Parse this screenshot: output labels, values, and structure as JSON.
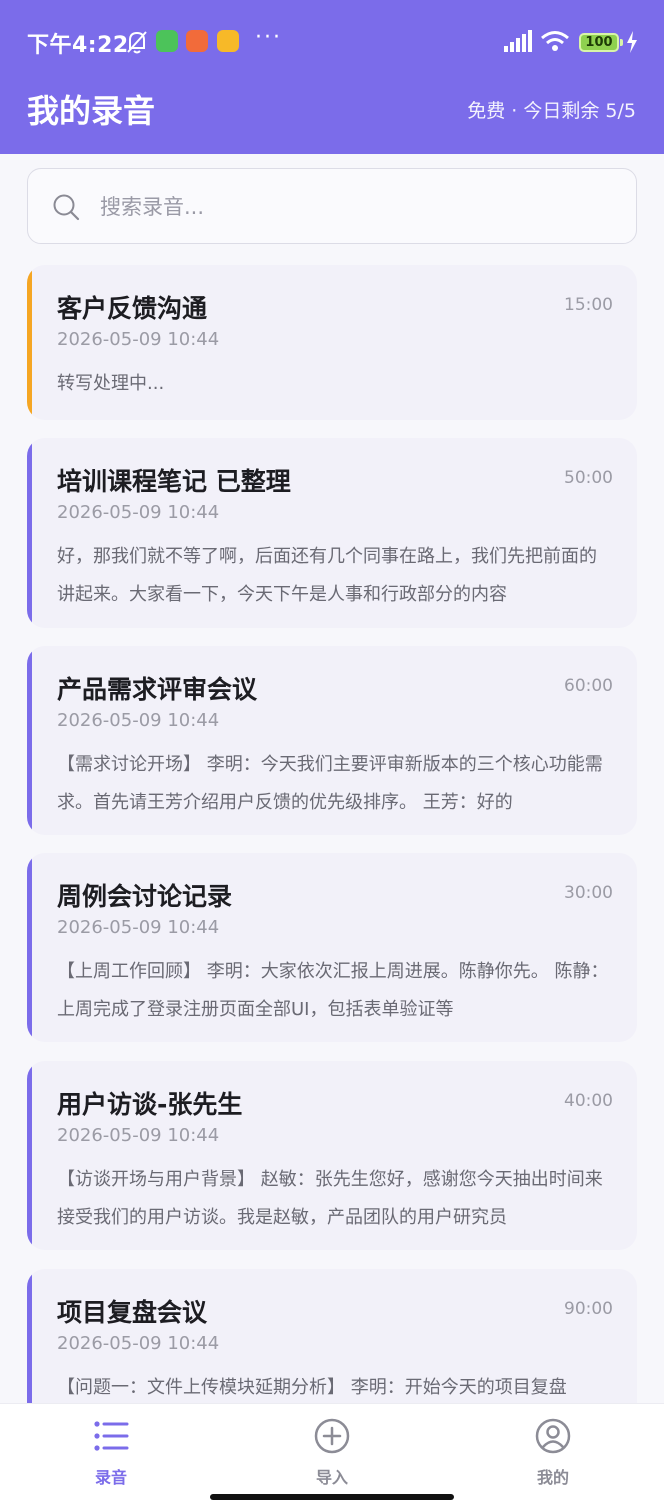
{
  "status_bar": {
    "time": "下午4:22",
    "more": "···",
    "battery": "100"
  },
  "header": {
    "title": "我的录音",
    "quota": "免费 · 今日剩余 5/5"
  },
  "search": {
    "placeholder": "搜索录音..."
  },
  "recordings": [
    {
      "title": "客户反馈沟通",
      "duration": "15:00",
      "date": "2026-05-09 10:44",
      "preview": "转写处理中...",
      "accent": "#f5a623"
    },
    {
      "title": "培训课程笔记 已整理",
      "duration": "50:00",
      "date": "2026-05-09 10:44",
      "preview": "好，那我们就不等了啊，后面还有几个同事在路上，我们先把前面的讲起来。大家看一下，今天下午是人事和行政部分的内容",
      "accent": "#7b6cea"
    },
    {
      "title": "产品需求评审会议",
      "duration": "60:00",
      "date": "2026-05-09 10:44",
      "preview": "【需求讨论开场】 李明：今天我们主要评审新版本的三个核心功能需求。首先请王芳介绍用户反馈的优先级排序。 王芳：好的",
      "accent": "#7b6cea"
    },
    {
      "title": "周例会讨论记录",
      "duration": "30:00",
      "date": "2026-05-09 10:44",
      "preview": "【上周工作回顾】 李明：大家依次汇报上周进展。陈静你先。 陈静：上周完成了登录注册页面全部UI，包括表单验证等",
      "accent": "#7b6cea"
    },
    {
      "title": "用户访谈-张先生",
      "duration": "40:00",
      "date": "2026-05-09 10:44",
      "preview": "【访谈开场与用户背景】 赵敏：张先生您好，感谢您今天抽出时间来接受我们的用户访谈。我是赵敏，产品团队的用户研究员",
      "accent": "#7b6cea"
    },
    {
      "title": "项目复盘会议",
      "duration": "90:00",
      "date": "2026-05-09 10:44",
      "preview": "【问题一：文件上传模块延期分析】 李明：开始今天的项目复盘",
      "accent": "#7b6cea"
    }
  ],
  "tabs": [
    {
      "label": "录音",
      "icon": "list-icon",
      "active": true
    },
    {
      "label": "导入",
      "icon": "plus-circle-icon",
      "active": false
    },
    {
      "label": "我的",
      "icon": "user-icon",
      "active": false
    }
  ],
  "colors": {
    "primary": "#7b6cea",
    "processing": "#f5a623",
    "tab_inactive": "#8c8c96"
  }
}
